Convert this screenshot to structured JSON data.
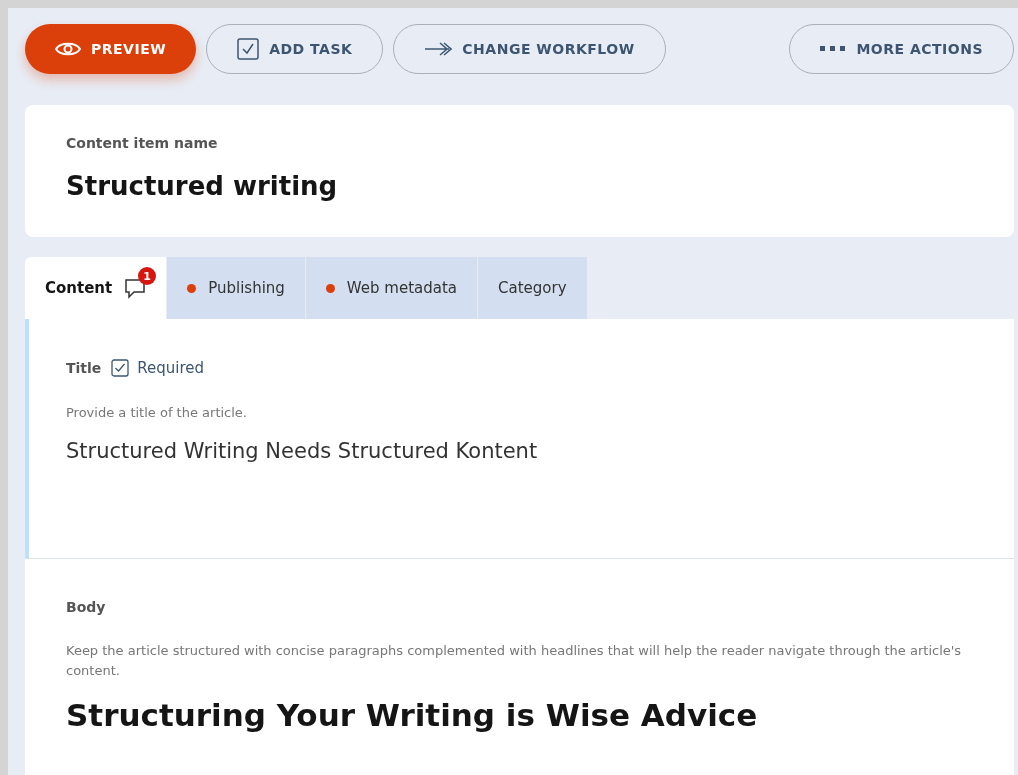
{
  "toolbar": [
    {
      "kind": "primary",
      "label": "PREVIEW"
    },
    {
      "kind": "outline",
      "label": "ADD TASK"
    },
    {
      "kind": "outline",
      "label": "CHANGE WORKFLOW"
    },
    {
      "kind": "more",
      "label": "MORE ACTIONS"
    }
  ],
  "item_name": {
    "label": "Content item name",
    "value": "Structured writing"
  },
  "tabs": [
    {
      "label": "Content",
      "selected": true,
      "comment_badge": "1",
      "warning": false
    },
    {
      "label": "Publishing",
      "selected": false,
      "warning": true
    },
    {
      "label": "Web metadata",
      "selected": false,
      "warning": true
    },
    {
      "label": "Category",
      "selected": false,
      "warning": false
    }
  ],
  "elements": [
    {
      "kind": "text",
      "label": "Title",
      "focused": true,
      "required": {
        "label": "Required",
        "checked": true
      },
      "guideline": "Provide a title of the article.",
      "value": "Structured Writing Needs Structured Kontent"
    },
    {
      "kind": "rich",
      "label": "Body",
      "focused": false,
      "guideline": "Keep the article structured with concise paragraphs complemented with headlines that will help the reader navigate through the article's content.",
      "value": "Structuring Your Writing is Wise Advice"
    }
  ]
}
